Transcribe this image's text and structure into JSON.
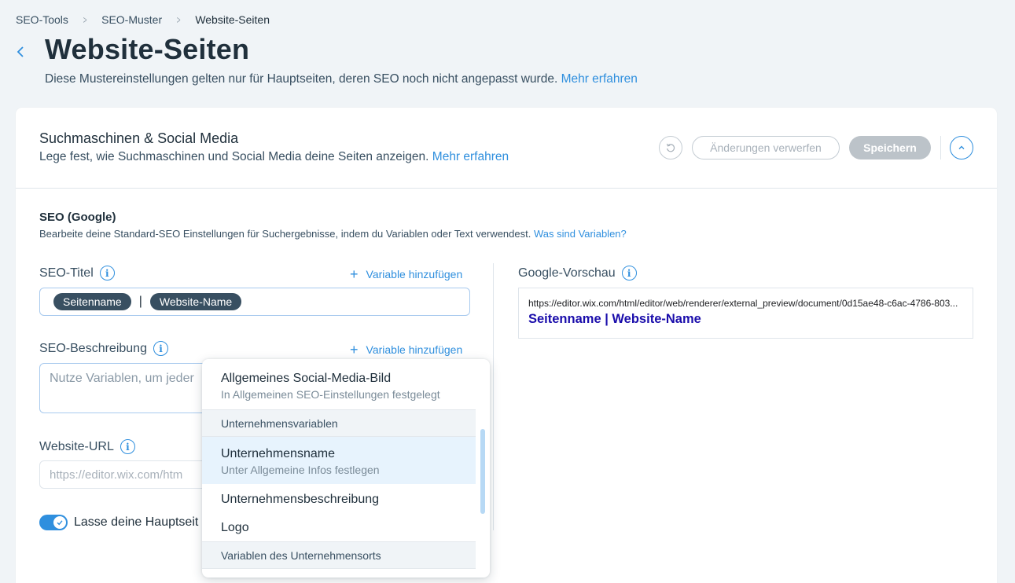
{
  "breadcrumb": {
    "items": [
      "SEO-Tools",
      "SEO-Muster",
      "Website-Seiten"
    ]
  },
  "header": {
    "title": "Website-Seiten",
    "subtitle": "Diese Mustereinstellungen gelten nur für Hauptseiten, deren SEO noch nicht angepasst wurde.",
    "learn_more": "Mehr erfahren"
  },
  "card": {
    "title": "Suchmaschinen & Social Media",
    "subtitle": "Lege fest, wie Suchmaschinen und Social Media deine Seiten anzeigen.",
    "learn_more": "Mehr erfahren",
    "discard_label": "Änderungen verwerfen",
    "save_label": "Speichern"
  },
  "seo": {
    "title": "SEO (Google)",
    "subtitle": "Bearbeite deine Standard-SEO Einstellungen für Suchergebnisse, indem du Variablen oder Text verwendest.",
    "vars_link": "Was sind Variablen?",
    "title_label": "SEO-Titel",
    "add_variable": "Variable hinzufügen",
    "title_chips": [
      "Seitenname",
      "Website-Name"
    ],
    "title_separator": "|",
    "desc_label": "SEO-Beschreibung",
    "desc_placeholder": "Nutze Variablen, um jeder",
    "url_label": "Website-URL",
    "url_placeholder": "https://editor.wix.com/htm",
    "toggle_label": "Lasse deine Hauptseit",
    "toggle_on": true
  },
  "preview": {
    "label": "Google-Vorschau",
    "url": "https://editor.wix.com/html/editor/web/renderer/external_preview/document/0d15ae48-c6ac-4786-803...",
    "title": "Seitenname | Website-Name"
  },
  "dropdown": {
    "item_social": "Allgemeines Social-Media-Bild",
    "item_social_sub": "In Allgemeinen SEO-Einstellungen festgelegt",
    "section_company": "Unternehmensvariablen",
    "item_company_name": "Unternehmensname",
    "item_company_name_sub": "Unter Allgemeine Infos festlegen",
    "item_company_desc": "Unternehmensbeschreibung",
    "item_logo": "Logo",
    "section_location": "Variablen des Unternehmensorts"
  },
  "colors": {
    "accent": "#2f8fde",
    "chip": "#384f61",
    "google_title": "#1a0dab"
  }
}
